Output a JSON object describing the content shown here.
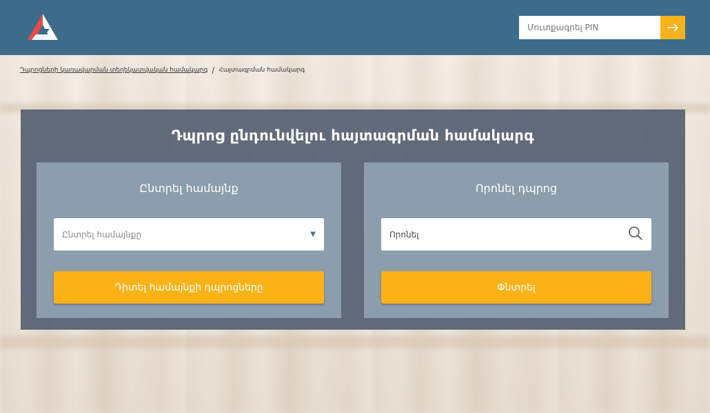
{
  "header": {
    "logo_icon": "triangle-logo-icon",
    "pin_placeholder": "Մուտքագրել PIN",
    "pin_submit_icon": "arrow-right-icon",
    "color_bar": "#3c6c89",
    "color_accent": "#f8b21c"
  },
  "breadcrumb": {
    "items": [
      "Դպրոցների կառավարման տեղեկատվական համակարգ",
      "Հայտագրման համակարգ"
    ]
  },
  "main": {
    "title": "Դպրոց ընդունվելու հայտագրման համակարգ",
    "left_card": {
      "title": "Ընտրել համայնք",
      "select_placeholder": "Ընտրել համայնքը",
      "select_icon": "caret-down-icon",
      "button_label": "Դիտել համայնքի դպրոցները"
    },
    "right_card": {
      "title": "Որոնել դպրոց",
      "search_value": "Որոնել",
      "search_icon": "search-icon",
      "button_label": "Փնտրել"
    }
  }
}
